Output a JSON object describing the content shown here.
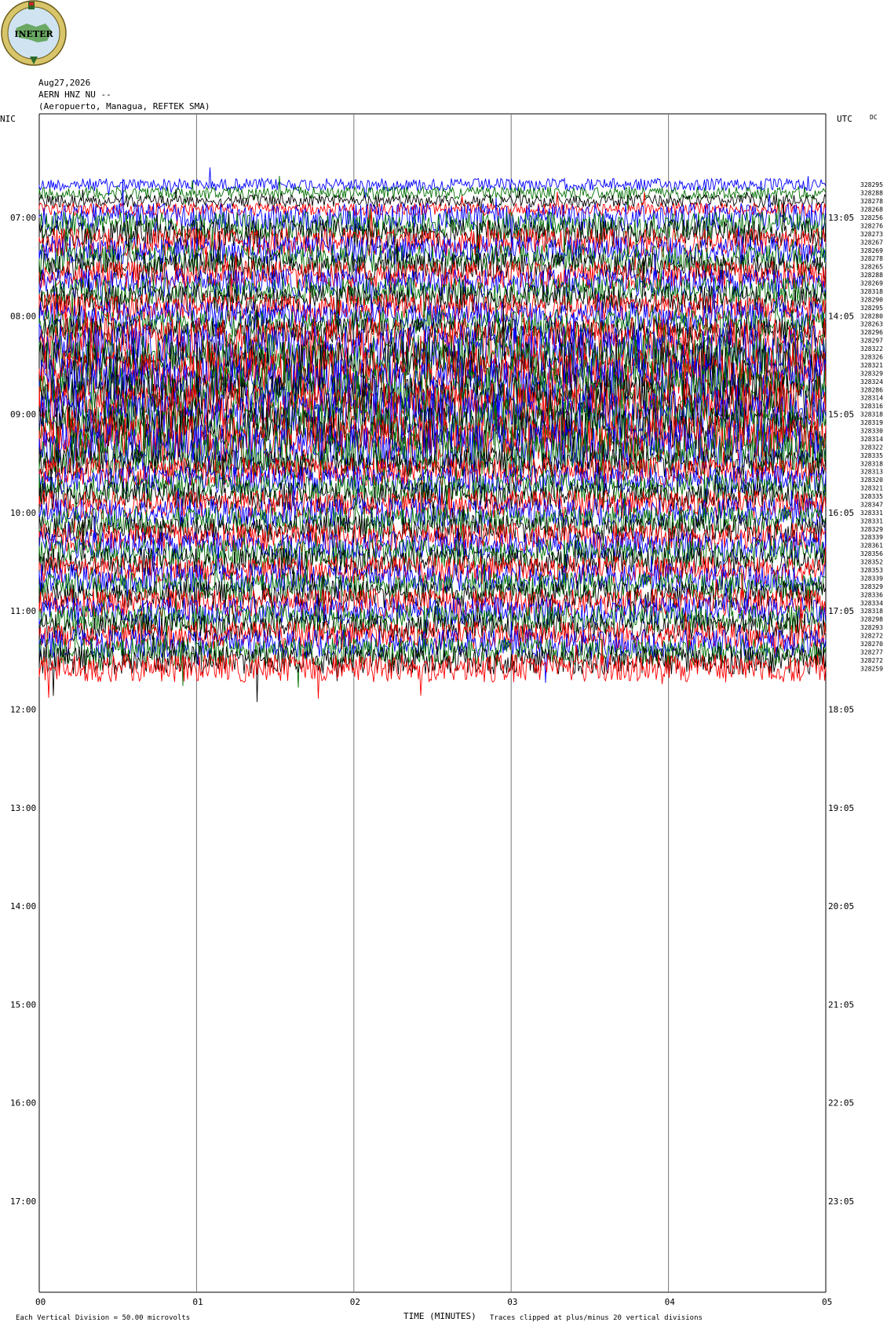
{
  "header": {
    "date": "Aug27,2026",
    "station": "AERN HNZ NU --",
    "location": "(Aeropuerto, Managua, REFTEK SMA)",
    "logo_text": "INETER",
    "left_zone": "NIC",
    "right_zone": "UTC",
    "dc_label": "DC"
  },
  "footer": {
    "scale_text": "Each Vertical Division =   50.00 microvolts",
    "xaxis_title": "TIME (MINUTES)",
    "clip_text": "Traces clipped at plus/minus 20 vertical divisions"
  },
  "chart_data": {
    "type": "line",
    "title": "AERN HNZ NU --",
    "xlabel": "TIME (MINUTES)",
    "xlim": [
      0,
      5
    ],
    "x_ticks": [
      "00",
      "01",
      "02",
      "03",
      "04",
      "05"
    ],
    "left_time_labels": [
      "07:00",
      "08:00",
      "09:00",
      "10:00",
      "11:00",
      "12:00",
      "13:00",
      "14:00",
      "15:00",
      "16:00",
      "17:00"
    ],
    "right_time_labels": [
      "13:05",
      "14:05",
      "15:05",
      "16:05",
      "17:05",
      "18:05",
      "19:05",
      "20:05",
      "21:05",
      "22:05",
      "23:05"
    ],
    "trace_colors": [
      "#0000ff",
      "#007000",
      "#000000",
      "#ff0000"
    ],
    "trace_start_time": "12:40",
    "trace_interval_minutes": 5,
    "scale_microvolts_per_division": 50.0,
    "clip_divisions": 20,
    "trace_dc_values": [
      "328295",
      "328288",
      "328278",
      "328268",
      "328256",
      "328276",
      "328273",
      "328267",
      "328269",
      "328278",
      "328265",
      "328288",
      "328269",
      "328318",
      "328290",
      "328295",
      "328280",
      "328263",
      "328296",
      "328297",
      "328322",
      "328326",
      "328321",
      "328329",
      "328324",
      "328286",
      "328314",
      "328316",
      "328318",
      "328319",
      "328330",
      "328314",
      "328322",
      "328335",
      "328318",
      "328313",
      "328320",
      "328321",
      "328335",
      "328347",
      "328331",
      "328331",
      "328329",
      "328339",
      "328361",
      "328356",
      "328352",
      "328353",
      "328339",
      "328329",
      "328336",
      "328334",
      "328318",
      "328298",
      "328293",
      "328272",
      "328270",
      "328277",
      "328272",
      "328259"
    ]
  }
}
